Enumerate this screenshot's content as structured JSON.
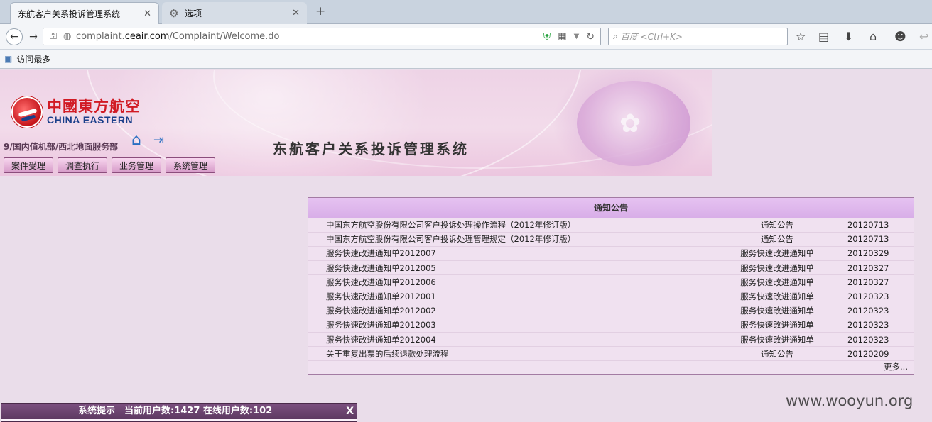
{
  "browser": {
    "tabs": [
      {
        "label": "东航客户关系投诉管理系统",
        "active": true
      },
      {
        "label": "选项",
        "active": false
      }
    ],
    "url_prefix": "complaint.",
    "url_domain": "ceair.com",
    "url_path": "/Complaint/Welcome.do",
    "search_placeholder": "百度 <Ctrl+K>",
    "bookmark": "访问最多"
  },
  "header": {
    "logo_cn": "中國東方航空",
    "logo_en": "CHINA EASTERN",
    "department": "9/国内值机部/西北地面服务部",
    "system_title": "东航客户关系投诉管理系统",
    "menu": [
      "案件受理",
      "调查执行",
      "业务管理",
      "系统管理"
    ]
  },
  "notice": {
    "title": "通知公告",
    "rows": [
      {
        "title": "中国东方航空股份有限公司客户投诉处理操作流程（2012年修订版）",
        "type": "通知公告",
        "date": "20120713"
      },
      {
        "title": "中国东方航空股份有限公司客户投诉处理管理规定（2012年修订版）",
        "type": "通知公告",
        "date": "20120713"
      },
      {
        "title": "服务快速改进通知单2012007",
        "type": "服务快速改进通知单",
        "date": "20120329"
      },
      {
        "title": "服务快速改进通知单2012005",
        "type": "服务快速改进通知单",
        "date": "20120327"
      },
      {
        "title": "服务快速改进通知单2012006",
        "type": "服务快速改进通知单",
        "date": "20120327"
      },
      {
        "title": "服务快速改进通知单2012001",
        "type": "服务快速改进通知单",
        "date": "20120323"
      },
      {
        "title": "服务快速改进通知单2012002",
        "type": "服务快速改进通知单",
        "date": "20120323"
      },
      {
        "title": "服务快速改进通知单2012003",
        "type": "服务快速改进通知单",
        "date": "20120323"
      },
      {
        "title": "服务快速改进通知单2012004",
        "type": "服务快速改进通知单",
        "date": "20120323"
      },
      {
        "title": "关于重复出票的后续退款处理流程",
        "type": "通知公告",
        "date": "20120209"
      }
    ],
    "more": "更多..."
  },
  "tip": {
    "text": "系统提示　当前用户数:1427 在线用户数:102",
    "close": "X"
  },
  "watermark": "www.wooyun.org"
}
